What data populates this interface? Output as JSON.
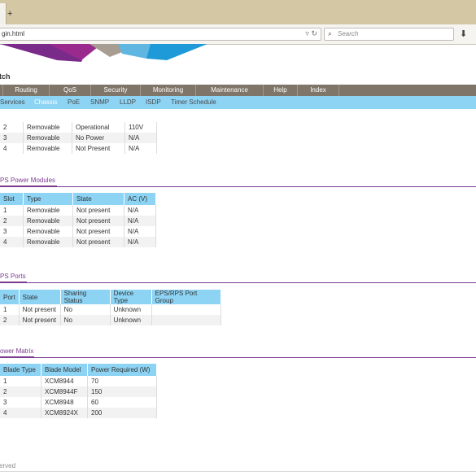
{
  "browser": {
    "new_tab_label": "+",
    "url": "gin.html",
    "search_placeholder": "Search"
  },
  "app": {
    "title": "tch"
  },
  "main_nav": [
    "Routing",
    "QoS",
    "Security",
    "Monitoring",
    "Maintenance",
    "Help",
    "Index"
  ],
  "sub_nav": [
    {
      "label": "Services",
      "active": false
    },
    {
      "label": "Chassis",
      "active": true
    },
    {
      "label": "PoE",
      "active": false
    },
    {
      "label": "SNMP",
      "active": false
    },
    {
      "label": "LLDP",
      "active": false
    },
    {
      "label": "ISDP",
      "active": false
    },
    {
      "label": "Timer Schedule",
      "active": false
    }
  ],
  "power_supply_partial": {
    "rows": [
      [
        "2",
        "Removable",
        "Operational",
        "110V"
      ],
      [
        "3",
        "Removable",
        "No Power",
        "N/A"
      ],
      [
        "4",
        "Removable",
        "Not Present",
        "N/A"
      ]
    ]
  },
  "eps_power_modules": {
    "title": "PS Power Modules",
    "headers": [
      "Slot",
      "Type",
      "State",
      "AC (V)"
    ],
    "rows": [
      [
        "1",
        "Removable",
        "Not present",
        "N/A"
      ],
      [
        "2",
        "Removable",
        "Not present",
        "N/A"
      ],
      [
        "3",
        "Removable",
        "Not present",
        "N/A"
      ],
      [
        "4",
        "Removable",
        "Not present",
        "N/A"
      ]
    ]
  },
  "eps_ports": {
    "title": "PS Ports",
    "headers": [
      "Port",
      "State",
      "Sharing Status",
      "Device Type",
      "EPS/RPS Port Group"
    ],
    "rows": [
      [
        "1",
        "Not present",
        "No",
        "Unknown",
        ""
      ],
      [
        "2",
        "Not present",
        "No",
        "Unknown",
        ""
      ]
    ]
  },
  "power_matrix": {
    "title": "ower Matrix",
    "headers": [
      "Blade Type",
      "Blade Model",
      "Power Required (W)"
    ],
    "rows": [
      [
        "1",
        "XCM8944",
        "70"
      ],
      [
        "2",
        "XCM8944F",
        "150"
      ],
      [
        "3",
        "XCM8948",
        "60"
      ],
      [
        "4",
        "XCM8924X",
        "200"
      ]
    ]
  },
  "footer": {
    "text": "erved"
  }
}
